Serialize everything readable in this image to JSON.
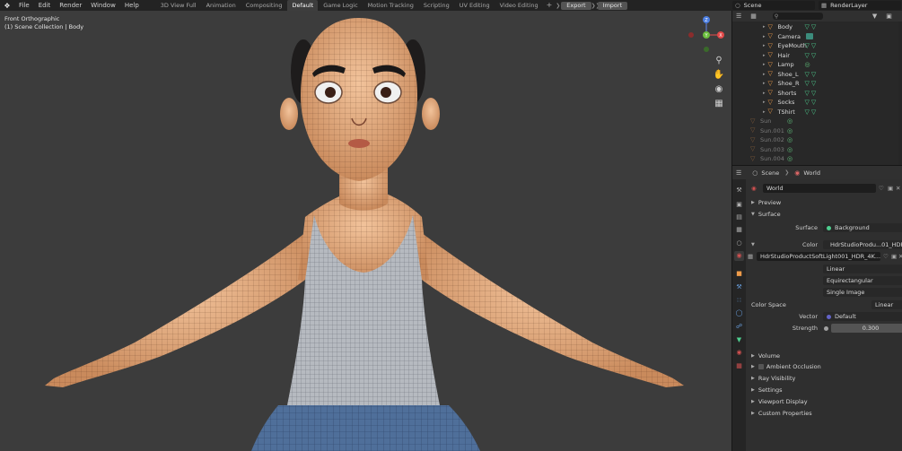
{
  "menus": [
    "File",
    "Edit",
    "Render",
    "Window",
    "Help"
  ],
  "workspaces": [
    {
      "label": "3D View Full",
      "active": false
    },
    {
      "label": "Animation",
      "active": false
    },
    {
      "label": "Compositing",
      "active": false
    },
    {
      "label": "Default",
      "active": true
    },
    {
      "label": "Game Logic",
      "active": false
    },
    {
      "label": "Motion Tracking",
      "active": false
    },
    {
      "label": "Scripting",
      "active": false
    },
    {
      "label": "UV Editing",
      "active": false
    },
    {
      "label": "Video Editing",
      "active": false
    }
  ],
  "workspace_add": "+",
  "export_label": "Export",
  "import_label": "Import",
  "scene_name": "Scene",
  "render_layer": "RenderLayer",
  "viewport": {
    "view_name": "Front Orthographic",
    "collection": "(1) Scene Collection | Body",
    "gizmo": {
      "z": "Z",
      "y": "Y",
      "x": "X"
    }
  },
  "outliner": {
    "items": [
      {
        "name": "Body",
        "dim": false,
        "extra": "tri"
      },
      {
        "name": "Camera",
        "dim": false,
        "extra": "cam"
      },
      {
        "name": "EyeMouth",
        "dim": false,
        "extra": "tri"
      },
      {
        "name": "Hair",
        "dim": false,
        "extra": "tri"
      },
      {
        "name": "Lamp",
        "dim": false,
        "extra": "lamp"
      },
      {
        "name": "Shoe_L",
        "dim": false,
        "extra": "tri"
      },
      {
        "name": "Shoe_R",
        "dim": false,
        "extra": "tri"
      },
      {
        "name": "Shorts",
        "dim": false,
        "extra": "tri"
      },
      {
        "name": "Socks",
        "dim": false,
        "extra": "tri"
      },
      {
        "name": "TShirt",
        "dim": false,
        "extra": "tri"
      },
      {
        "name": "Sun",
        "dim": true,
        "extra": "lamp"
      },
      {
        "name": "Sun.001",
        "dim": true,
        "extra": "lamp"
      },
      {
        "name": "Sun.002",
        "dim": true,
        "extra": "lamp"
      },
      {
        "name": "Sun.003",
        "dim": true,
        "extra": "lamp"
      },
      {
        "name": "Sun.004",
        "dim": true,
        "extra": "lamp"
      }
    ]
  },
  "properties": {
    "breadcrumb_scene": "Scene",
    "breadcrumb_world": "World",
    "world_name": "World",
    "panels": {
      "preview": "Preview",
      "surface": "Surface",
      "volume": "Volume",
      "ambient_occlusion": "Ambient Occlusion",
      "ray_visibility": "Ray Visibility",
      "settings": "Settings",
      "viewport_display": "Viewport Display",
      "custom_properties": "Custom Properties"
    },
    "surface_label": "Surface",
    "surface_value": "Background",
    "color_label": "Color",
    "color_value": "HdrStudioProdu...01_HDR_4K.exr",
    "image_name": "HdrStudioProductSoftLight001_HDR_4K...",
    "interpolation": "Linear",
    "projection": "Equirectangular",
    "source": "Single Image",
    "color_space_label": "Color Space",
    "color_space_value": "Linear",
    "vector_label": "Vector",
    "vector_value": "Default",
    "strength_label": "Strength",
    "strength_value": "0.300"
  },
  "colors": {
    "accent_green": "#4ecf8f",
    "socket_yellow": "#c7c729",
    "socket_purple": "#6363c7",
    "object_orange": "#ee9b4a"
  }
}
